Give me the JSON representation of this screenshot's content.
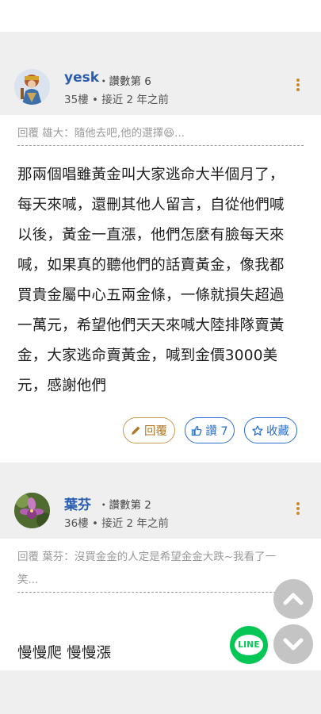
{
  "posts": [
    {
      "username": "yesk",
      "likes_text": "讚數第 6",
      "floor": "35樓",
      "time": "接近 2 年之前",
      "reply_quote": "回覆 雄大：隨他去吧,他的選擇😆...",
      "content_lines": [
        "那兩個唱雖黃金叫大家逃命大半個月了，",
        "每天來喊，還刪其他人留言，自從他們喊",
        "以後，黃金一直漲，他們怎麼有臉每天來",
        "喊，如果真的聽他們的話賣黃金，像我都",
        "買貴金屬中心五兩金條，一條就損失超過",
        "一萬元，希望他們天天來喊大陸排隊賣黃",
        "金，大家逃命賣黃金，喊到金價3000美",
        "元，感謝他們"
      ],
      "actions": {
        "reply": "回覆",
        "like": "讚 7",
        "save": "收藏"
      }
    },
    {
      "username": "葉芬",
      "likes_text": "讚數第 2",
      "floor": "36樓",
      "time": "接近 2 年之前",
      "reply_quote_line1": "回覆 葉芬：沒買金金的人定是希望金金大跌~我看了一",
      "reply_quote_line2": "笑...",
      "content": "慢慢爬 慢慢漲"
    }
  ],
  "fab": {
    "line_label": "LINE"
  },
  "icons": [
    "pencil-icon",
    "thumbs-up-icon",
    "star-icon",
    "chevron-up-icon",
    "chevron-down-icon",
    "line-logo-icon",
    "more-vertical-icon"
  ],
  "colors": {
    "username": "#2a5db0",
    "reply_btn": "#c99a4a",
    "like_btn": "#2a6fd0",
    "line_green": "#06c755"
  }
}
